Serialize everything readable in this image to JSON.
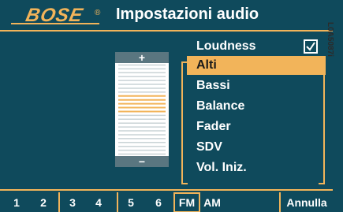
{
  "header": {
    "brand": "BOSE",
    "registered": "®",
    "title": "Impostazioni audio"
  },
  "slider": {
    "plus_label": "+",
    "minus_label": "−",
    "level": 0.42
  },
  "menu": {
    "items": [
      {
        "label": "Loudness",
        "checked": true
      },
      {
        "label": "Alti",
        "selected": true
      },
      {
        "label": "Bassi"
      },
      {
        "label": "Balance"
      },
      {
        "label": "Fader"
      },
      {
        "label": "SDV"
      },
      {
        "label": "Vol. Iniz."
      }
    ]
  },
  "bottom": {
    "presets": [
      "1",
      "2",
      "3",
      "4",
      "5",
      "6"
    ],
    "fm": "FM",
    "am": "AM",
    "cancel": "Annulla"
  },
  "side_code": "L0A5087i",
  "colors": {
    "background": "#0f4a5c",
    "accent": "#f2b45a",
    "text": "#ffffff"
  }
}
